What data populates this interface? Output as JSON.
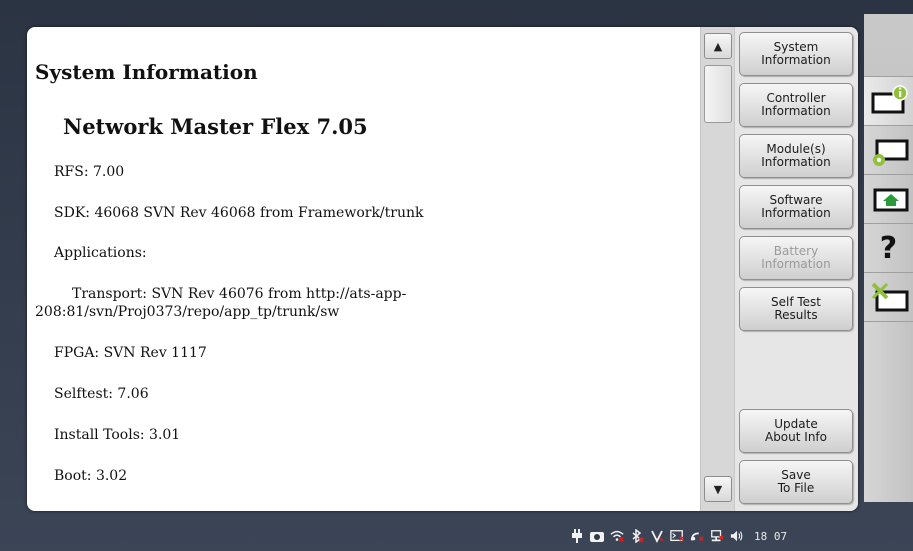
{
  "content": {
    "heading": "System Information",
    "subheading": "Network Master Flex 7.05",
    "rfs": "RFS: 7.00",
    "sdk": "SDK: 46068 SVN Rev 46068 from Framework/trunk",
    "applications": "Applications:",
    "transport_line1": "Transport: SVN Rev 46076 from http://ats-app-",
    "transport_line2": "208:81/svn/Proj0373/repo/app_tp/trunk/sw",
    "fpga": "FPGA: SVN Rev 1117",
    "selftest": "Selftest: 7.06",
    "install_tools": "Install Tools: 3.01",
    "boot": "Boot: 3.02"
  },
  "scrollbar": {
    "up_icon": "triangle-up",
    "down_icon": "triangle-down",
    "up_glyph": "▲",
    "down_glyph": "▼"
  },
  "side_menu": {
    "system_information": "System\nInformation",
    "controller_information": "Controller\nInformation",
    "modules_information": "Module(s)\nInformation",
    "software_information": "Software\nInformation",
    "battery_information": "Battery\nInformation",
    "self_test_results": "Self Test\nResults",
    "update_about_info": "Update\nAbout Info",
    "save_to_file": "Save\nTo File"
  },
  "right_tabs": {
    "icons": [
      "info-folder-icon",
      "settings-folder-icon",
      "home-folder-icon",
      "help-icon",
      "tools-folder-icon"
    ],
    "help_glyph": "?"
  },
  "status_bar": {
    "icons": [
      "power-plug-icon",
      "camera-icon",
      "wifi-icon",
      "bluetooth-icon",
      "v-icon",
      "terminal-icon",
      "satellite-icon",
      "network-icon",
      "speaker-icon"
    ],
    "clock": "18 07"
  },
  "colors": {
    "background": "#2b3443",
    "panel": "#ffffff",
    "disabled_text": "#9a9a9a",
    "status_red": "#e02020"
  }
}
